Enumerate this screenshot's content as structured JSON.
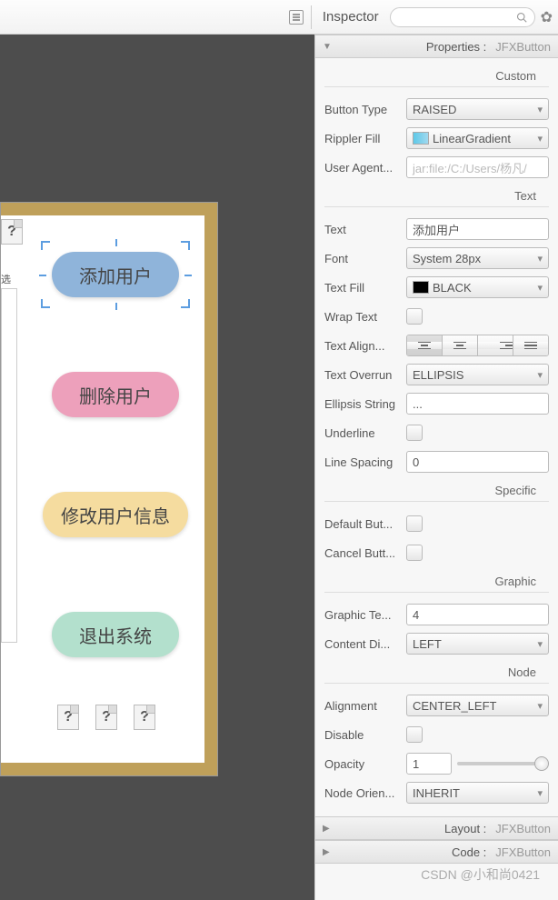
{
  "topbar": {
    "inspector_label": "Inspector"
  },
  "canvas": {
    "side_label": "选",
    "buttons": {
      "b1": "添加用户",
      "b2": "删除用户",
      "b3": "修改用户信息",
      "b4": "退出系统"
    },
    "unknown_glyph": "?"
  },
  "accordion": {
    "properties": {
      "label": "Properties :",
      "value": "JFXButton"
    },
    "layout": {
      "label": "Layout :",
      "value": "JFXButton"
    },
    "code": {
      "label": "Code :",
      "value": "JFXButton"
    }
  },
  "sections": {
    "custom": "Custom",
    "text": "Text",
    "specific": "Specific",
    "graphic": "Graphic",
    "node": "Node"
  },
  "props": {
    "button_type": {
      "label": "Button Type",
      "value": "RAISED"
    },
    "rippler_fill": {
      "label": "Rippler Fill",
      "value": "LinearGradient"
    },
    "user_agent": {
      "label": "User Agent...",
      "value": "jar:file:/C:/Users/杨凡/"
    },
    "text": {
      "label": "Text",
      "value": "添加用户"
    },
    "font": {
      "label": "Font",
      "value": "System 28px"
    },
    "text_fill": {
      "label": "Text Fill",
      "value": "BLACK"
    },
    "wrap_text": {
      "label": "Wrap Text"
    },
    "text_align": {
      "label": "Text Align..."
    },
    "text_overrun": {
      "label": "Text Overrun",
      "value": "ELLIPSIS"
    },
    "ellipsis_string": {
      "label": "Ellipsis String",
      "value": "..."
    },
    "underline": {
      "label": "Underline"
    },
    "line_spacing": {
      "label": "Line Spacing",
      "value": "0"
    },
    "default_button": {
      "label": "Default But..."
    },
    "cancel_button": {
      "label": "Cancel Butt..."
    },
    "graphic_text_gap": {
      "label": "Graphic Te...",
      "value": "4"
    },
    "content_display": {
      "label": "Content Di...",
      "value": "LEFT"
    },
    "alignment": {
      "label": "Alignment",
      "value": "CENTER_LEFT"
    },
    "disable": {
      "label": "Disable"
    },
    "opacity": {
      "label": "Opacity",
      "value": "1"
    },
    "node_orientation": {
      "label": "Node Orien...",
      "value": "INHERIT"
    }
  },
  "watermark": "CSDN @小和尚0421"
}
